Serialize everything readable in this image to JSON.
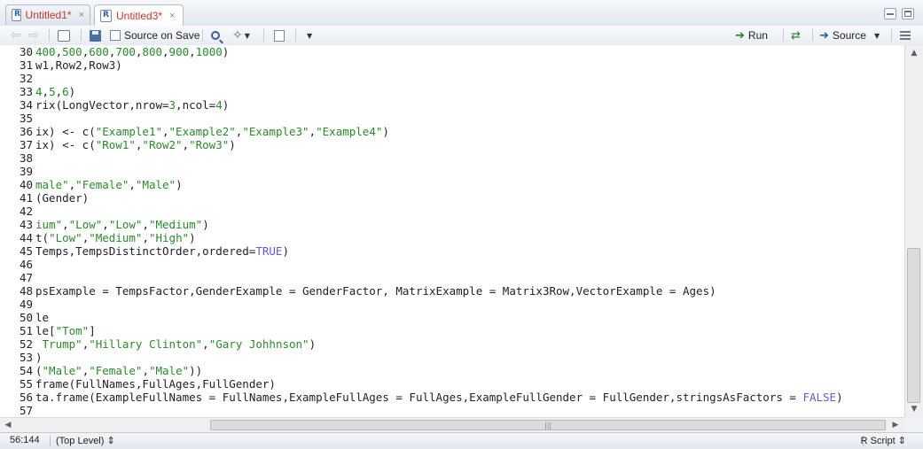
{
  "tabs": [
    {
      "label": "Untitled1*",
      "close": "×",
      "active": false
    },
    {
      "label": "Untitled3*",
      "close": "×",
      "active": true
    }
  ],
  "toolbar": {
    "source_on_save": "Source on Save",
    "run": "Run",
    "source": "Source"
  },
  "editor": {
    "lines": [
      {
        "n": "30",
        "t": "400,500,600,700,800,900,1000)"
      },
      {
        "n": "31",
        "t": "w1,Row2,Row3)"
      },
      {
        "n": "32",
        "t": ""
      },
      {
        "n": "33",
        "t": "4,5,6)"
      },
      {
        "n": "34",
        "t": "rix(LongVector,nrow=3,ncol=4)"
      },
      {
        "n": "35",
        "t": ""
      },
      {
        "n": "36",
        "t": "ix) <- c(\"Example1\",\"Example2\",\"Example3\",\"Example4\")"
      },
      {
        "n": "37",
        "t": "ix) <- c(\"Row1\",\"Row2\",\"Row3\")"
      },
      {
        "n": "38",
        "t": ""
      },
      {
        "n": "39",
        "t": ""
      },
      {
        "n": "40",
        "t": "male\",\"Female\",\"Male\")"
      },
      {
        "n": "41",
        "t": "(Gender)"
      },
      {
        "n": "42",
        "t": ""
      },
      {
        "n": "43",
        "t": "ium\",\"Low\",\"Low\",\"Medium\")"
      },
      {
        "n": "44",
        "t": "t(\"Low\",\"Medium\",\"High\")"
      },
      {
        "n": "45",
        "t": "Temps,TempsDistinctOrder,ordered=TRUE)"
      },
      {
        "n": "46",
        "t": ""
      },
      {
        "n": "47",
        "t": ""
      },
      {
        "n": "48",
        "t": "psExample = TempsFactor,GenderExample = GenderFactor, MatrixExample = Matrix3Row,VectorExample = Ages)"
      },
      {
        "n": "49",
        "t": ""
      },
      {
        "n": "50",
        "t": "le"
      },
      {
        "n": "51",
        "t": "le[\"Tom\"]"
      },
      {
        "n": "52",
        "t": " Trump\",\"Hillary Clinton\",\"Gary Johhnson\")"
      },
      {
        "n": "53",
        "t": ")"
      },
      {
        "n": "54",
        "t": "(\"Male\",\"Female\",\"Male\"))"
      },
      {
        "n": "55",
        "t": "frame(FullNames,FullAges,FullGender)"
      },
      {
        "n": "56",
        "t": "ta.frame(ExampleFullNames = FullNames,ExampleFullAges = FullAges,ExampleFullGender = FullGender,stringsAsFactors = FALSE)"
      },
      {
        "n": "57",
        "t": ""
      }
    ]
  },
  "status": {
    "position": "56:144",
    "scope": "(Top Level) ⇕",
    "file_type": "R Script ⇕"
  },
  "colors": {
    "string": "#2a8a2a",
    "number": "#2a8a2a",
    "keyword": "#6a5acd",
    "tab_label": "#c0392b"
  }
}
